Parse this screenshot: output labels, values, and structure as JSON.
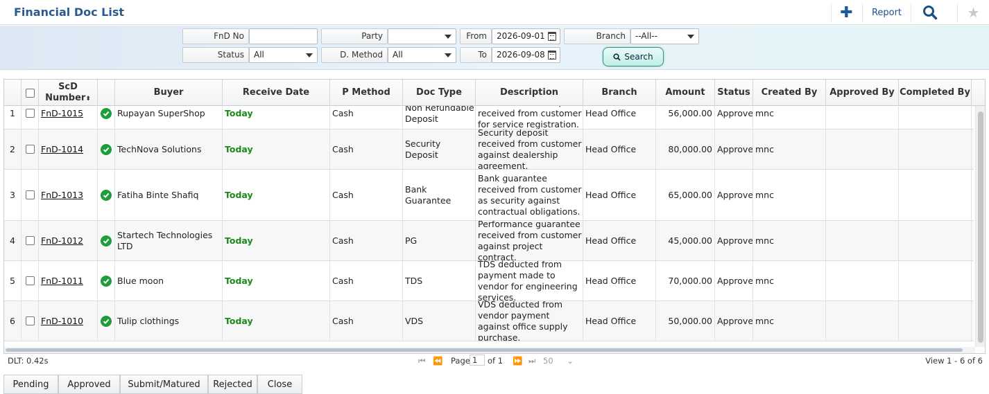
{
  "header": {
    "title": "Financial Doc List",
    "report_label": "Report"
  },
  "filters": {
    "fnd_no_label": "FnD No",
    "fnd_no_value": "",
    "party_label": "Party",
    "party_value": "",
    "from_label": "From",
    "from_value": "2026-09-01",
    "branch_label": "Branch",
    "branch_value": "--All--",
    "status_label": "Status",
    "status_value": "All",
    "dmethod_label": "D. Method",
    "dmethod_value": "All",
    "to_label": "To",
    "to_value": "2026-09-08",
    "search_label": "Search"
  },
  "grid": {
    "columns": {
      "scd1": "ScD",
      "scd2": "Number",
      "buyer": "Buyer",
      "receive_date": "Receive Date",
      "p_method": "P Method",
      "doc_type": "Doc Type",
      "description": "Description",
      "branch": "Branch",
      "amount": "Amount",
      "status": "Status",
      "created_by": "Created By",
      "approved_by": "Approved By",
      "completed_by": "Completed By"
    },
    "rows": [
      {
        "idx": "1",
        "number": "FnD-1015",
        "buyer": "Rupayan SuperShop",
        "date": "Today",
        "pmethod": "Cash",
        "doctype": "Non Refundable Deposit",
        "desc": "Non-refundable deposit received from customer for service registration.",
        "branch": "Head Office",
        "amount": "56,000.00",
        "status": "Approved",
        "created": "mnc",
        "approved": "",
        "completed": ""
      },
      {
        "idx": "2",
        "number": "FnD-1014",
        "buyer": "TechNova Solutions",
        "date": "Today",
        "pmethod": "Cash",
        "doctype": "Security Deposit",
        "desc": "Security deposit received from customer against dealership agreement.",
        "branch": "Head Office",
        "amount": "80,000.00",
        "status": "Approved",
        "created": "mnc",
        "approved": "",
        "completed": ""
      },
      {
        "idx": "3",
        "number": "FnD-1013",
        "buyer": "Fatiha Binte Shafiq",
        "date": "Today",
        "pmethod": "Cash",
        "doctype": "Bank Guarantee",
        "desc": "Bank guarantee received from customer as security against contractual obligations.",
        "branch": "Head Office",
        "amount": "65,000.00",
        "status": "Approved",
        "created": "mnc",
        "approved": "",
        "completed": ""
      },
      {
        "idx": "4",
        "number": "FnD-1012",
        "buyer": "Startech Technologies LTD",
        "date": "Today",
        "pmethod": "Cash",
        "doctype": "PG",
        "desc": "Performance guarantee received from customer against project contract.",
        "branch": "Head Office",
        "amount": "45,000.00",
        "status": "Approved",
        "created": "mnc",
        "approved": "",
        "completed": ""
      },
      {
        "idx": "5",
        "number": "FnD-1011",
        "buyer": "Blue moon",
        "date": "Today",
        "pmethod": "Cash",
        "doctype": "TDS",
        "desc": "TDS deducted from payment made to vendor for engineering services.",
        "branch": "Head Office",
        "amount": "70,000.00",
        "status": "Approved",
        "created": "mnc",
        "approved": "",
        "completed": ""
      },
      {
        "idx": "6",
        "number": "FnD-1010",
        "buyer": "Tulip clothings",
        "date": "Today",
        "pmethod": "Cash",
        "doctype": "VDS",
        "desc": "VDS deducted from vendor payment against office supply purchase.",
        "branch": "Head Office",
        "amount": "50,000.00",
        "status": "Approved",
        "created": "mnc",
        "approved": "",
        "completed": ""
      }
    ]
  },
  "pager": {
    "dlt": "DLT: 0.42s",
    "page_label": "Page",
    "page_value": "1",
    "of_label": "of 1",
    "page_size": "50",
    "view_text": "View 1 - 6 of 6"
  },
  "tabs": [
    "Pending",
    "Approved",
    "Submit/Matured",
    "Rejected",
    "Close"
  ]
}
